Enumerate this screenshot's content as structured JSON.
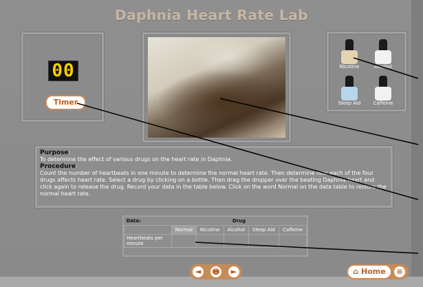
{
  "title": "Daphnia Heart Rate Lab",
  "timer": {
    "display": "00",
    "button_label": "Timer"
  },
  "drugs": [
    {
      "label": "Nicotine"
    },
    {
      "label": "Alcohol"
    },
    {
      "label": "Sleep Aid"
    },
    {
      "label": "Caffeine"
    }
  ],
  "purpose": {
    "heading": "Purpose",
    "text": "To determine the effect of various drugs on the heart rate in Daphnia."
  },
  "procedure": {
    "heading": "Procedure",
    "text": "Count the number of heartbeats in one minute to determine the normal heart rate. Then determine how each of the four drugs affects heart rate. Select a drug by clicking on a bottle. Then drag the dropper over the beating Daphnia heart and click again to release the drug. Record your data in the table below. Click on the word Normal on the data table to restore the normal heart rate."
  },
  "data_table": {
    "title": "Data:",
    "group_header": "Drug",
    "columns": [
      "Normal",
      "Nicotine",
      "Alcohol",
      "Sleep Aid",
      "Caffeine"
    ],
    "row_label": "Heartbeats per minute"
  },
  "nav": {
    "prev": "◄",
    "print": "🖶",
    "next": "►",
    "home_label": "Home"
  },
  "colors": {
    "accent": "#c78b58",
    "accent_text": "#c05f1e",
    "background": "#8c8c8c"
  }
}
